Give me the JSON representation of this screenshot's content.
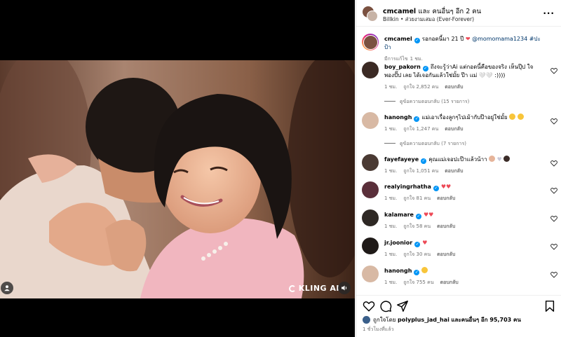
{
  "media": {
    "watermark": "KLING AI",
    "user_tag_icon": "user-icon",
    "mute_icon": "speaker-icon"
  },
  "header": {
    "author": "cmcamel",
    "collab_text": "และ คนอื่นๆ อีก 2 คน",
    "music": "Billkin • ส่วยงามเสมอ (Ever-Forever)",
    "more_icon": "more-icon"
  },
  "caption": {
    "username": "cmcamel",
    "text": "รอกอดนี้มา 21 ปี",
    "emoji": "❤",
    "mentions": "@momomama1234 #ปะป้า",
    "translate": "มีการแก้ไข",
    "time": "1 ชม."
  },
  "comments": [
    {
      "username": "boy_pakorn",
      "text": "ถึงจะรู้ว่าAi แต่กอดนี้คือของจริง เห็นปุ๊ป ใจพองปั๊ป เลย ได้เจอกันแล้วใช่มั้ย ป๊า แม่ 🤍🤍 :))))",
      "time": "1 ชม.",
      "likes": "ถูกใจ 2,852 คน",
      "reply": "ตอบกลับ",
      "view_replies": "ดูข้อความตอบกลับ (15 รายการ)"
    },
    {
      "username": "hanongh",
      "text": "แม่เอาเรื่องลูกๆไปเม้ากับป๊าอยู่ใช่มั้ย",
      "time": "1 ชม.",
      "likes": "ถูกใจ 1,247 คน",
      "reply": "ตอบกลับ",
      "view_replies": "ดูข้อความตอบกลับ (7 รายการ)"
    },
    {
      "username": "fayefayeye",
      "text": "คุณแม่เจอปะป๊าแล้วน้าา",
      "time": "1 ชม.",
      "likes": "ถูกใจ 1,051 คน",
      "reply": "ตอบกลับ"
    },
    {
      "username": "realyingrhatha",
      "text": "",
      "time": "1 ชม.",
      "likes": "ถูกใจ 81 คน",
      "reply": "ตอบกลับ"
    },
    {
      "username": "kalamare",
      "text": "",
      "time": "1 ชม.",
      "likes": "ถูกใจ 58 คน",
      "reply": "ตอบกลับ"
    },
    {
      "username": "jr.joonior",
      "text": "",
      "time": "1 ชม.",
      "likes": "ถูกใจ 30 คน",
      "reply": "ตอบกลับ"
    },
    {
      "username": "hanongh",
      "text": "",
      "time": "1 ชม.",
      "likes": "ถูกใจ 755 คน",
      "reply": "ตอบกลับ"
    }
  ],
  "actions": {
    "liked_by_prefix": "ถูกใจโดย",
    "liked_by_user": "polyplus_jad_hai",
    "liked_by_suffix": "และคนอื่นๆ อีก 95,703 คน",
    "time_ago": "1 ชั่วโมงที่แล้ว"
  },
  "colors": {
    "verified": "#0095f6",
    "link": "#00376b",
    "heart": "#ed4956",
    "muted_text": "#737373"
  }
}
